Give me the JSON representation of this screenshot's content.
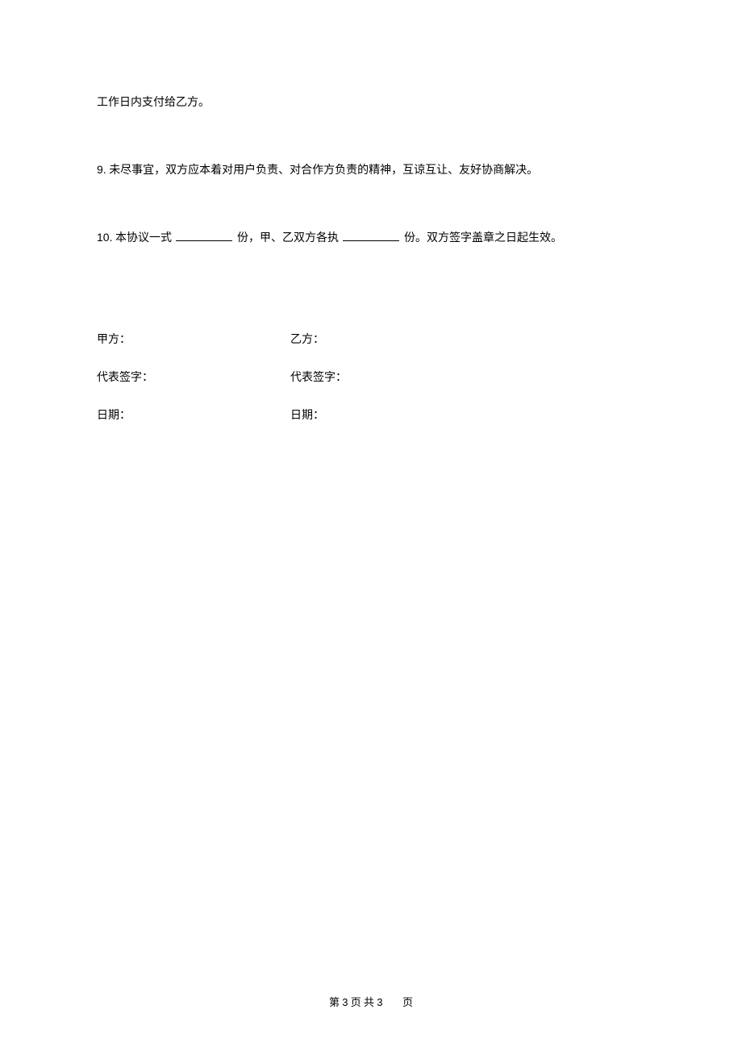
{
  "paragraphs": {
    "p1": "工作日内支付给乙方。",
    "p9_num": "9.",
    "p9_text": " 未尽事宜，双方应本着对用户负责、对合作方负责的精神，互谅互让、友好协商解决。",
    "p10_num": "10.",
    "p10_a": " 本协议一式 ",
    "p10_b": " 份，甲、乙双方各执 ",
    "p10_c": " 份。双方签字盖章之日起生效。"
  },
  "signatures": {
    "partyA": {
      "label": "甲方：",
      "sign": "代表签字：",
      "date": "日期："
    },
    "partyB": {
      "label": "乙方：",
      "sign": "代表签字：",
      "date": "日期："
    }
  },
  "footer": {
    "a": "第",
    "page": "3",
    "b": "页 共",
    "total": "3",
    "c": "页"
  }
}
